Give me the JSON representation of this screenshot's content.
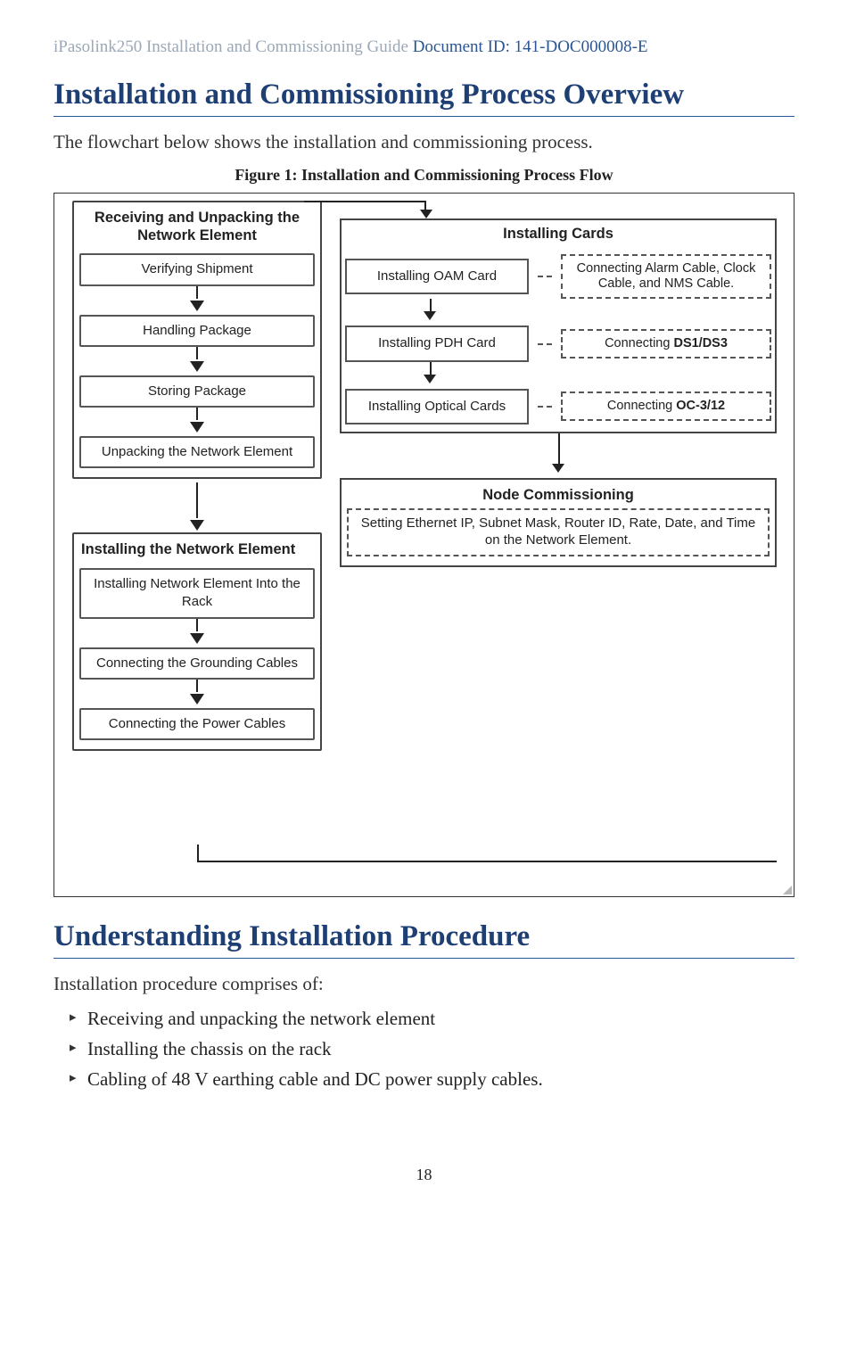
{
  "header": {
    "product_title": "iPasolink250 Installation and Commissioning Guide",
    "doc_id_label": "Document ID: 141-DOC000008-E"
  },
  "section1": {
    "title": "Installation and Commissioning Process Overview",
    "intro": "The flowchart below shows the installation and commissioning process.",
    "figure_caption": "Figure 1: Installation and Commissioning Process Flow"
  },
  "flowchart": {
    "groupA1": {
      "title": "Receiving and Unpacking the Network Element",
      "steps": [
        "Verifying Shipment",
        "Handling Package",
        "Storing  Package",
        "Unpacking the Network Element"
      ]
    },
    "groupA2": {
      "title": "Installing the Network Element",
      "steps": [
        "Installing Network Element Into the Rack",
        "Connecting the Grounding Cables",
        "Connecting the  Power Cables"
      ]
    },
    "groupB1": {
      "title": "Installing Cards",
      "rows": [
        {
          "step": "Installing OAM  Card",
          "conn": "Connecting Alarm Cable, Clock Cable, and NMS Cable."
        },
        {
          "step": "Installing PDH  Card",
          "conn_prefix": "Connecting ",
          "conn_bold": "DS1/DS3"
        },
        {
          "step": "Installing Optical Cards",
          "conn_prefix": "Connecting ",
          "conn_bold": "OC-3/12"
        }
      ]
    },
    "groupB2": {
      "title": "Node Commissioning",
      "box": "Setting Ethernet IP, Subnet Mask, Router ID, Rate, Date, and Time on the Network Element."
    }
  },
  "section2": {
    "title": "Understanding Installation Procedure",
    "intro": "Installation procedure comprises of:",
    "bullets": [
      "Receiving and unpacking the network element",
      "Installing the chassis on the rack",
      "Cabling of 48 V earthing cable and DC power supply cables."
    ]
  },
  "page_number": "18"
}
